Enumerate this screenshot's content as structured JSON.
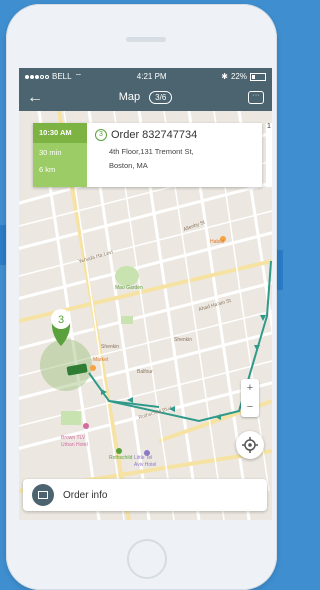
{
  "status": {
    "carrier": "BELL",
    "time": "4:21 PM",
    "battery": "22%"
  },
  "nav": {
    "back_icon": "arrow-left-icon",
    "title": "Map",
    "counter": "3/6",
    "chat_icon": "chat-bubble-icon"
  },
  "order_card": {
    "time": "10:30 AM",
    "duration": "30 min",
    "distance": "6 km",
    "stop_number": "3",
    "order_title": "Order 832747734",
    "address_line1": "4th Floor,131 Tremont St,",
    "address_line2": "Boston, MA",
    "next_card_peek": "1"
  },
  "map": {
    "pin_label": "3",
    "poi": {
      "mao_garden": "Mao Garden",
      "habibi": "Habibi",
      "brown_tlv": "Brown TLV",
      "brown_tlv2": "Urban Hotel",
      "rothschild": "Rothschild",
      "little_tel_aviv": "Little Tel",
      "little_tel_aviv2": "Aviv Hotel",
      "market": "Market"
    },
    "streets": {
      "shenkin": "Shenkin",
      "shenkin2": "Shenkin",
      "balfour": "Balfour",
      "rothschild_blvd": "Rothschild Blvd",
      "allenby": "Allenby St",
      "yehuda": "Yehuda Ha-Levi",
      "ahad_haam": "Ahad Ha'am St"
    },
    "route_color": "#2f9a8a",
    "zoom_in": "+",
    "zoom_out": "−"
  },
  "footer": {
    "order_info_label": "Order info",
    "order_info_icon": "calendar-icon"
  }
}
